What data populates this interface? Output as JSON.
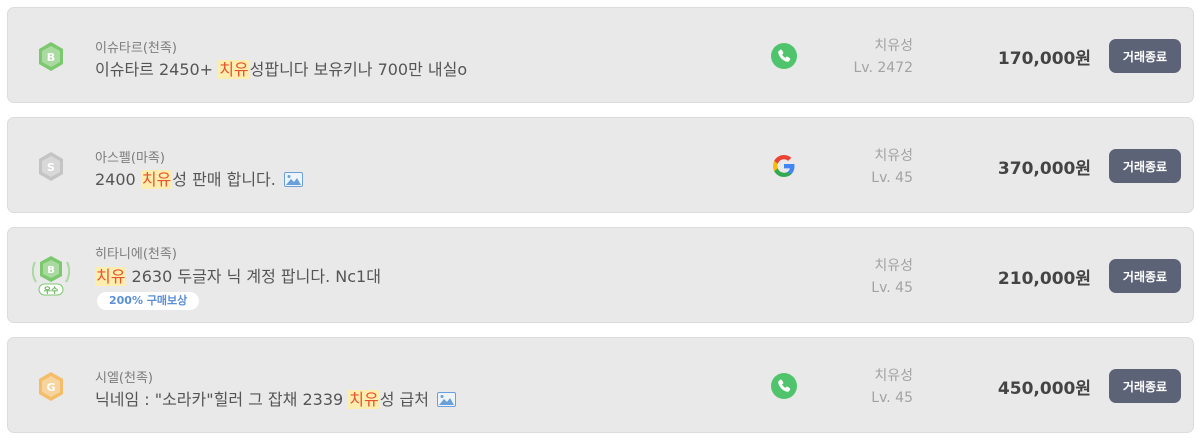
{
  "listings": [
    {
      "seller": "이슈타르(천족)",
      "title_pre": "이슈타르 2450+ ",
      "title_hl": "치유",
      "title_post": "성팝니다 보유키나 700만 내실o",
      "badge_letter": "B",
      "badge_color": "#7cc86f",
      "badge_label": "",
      "contact_icon": "phone-icon",
      "job": "치유성",
      "level": "Lv. 2472",
      "price": "170,000원",
      "action": "거래종료"
    },
    {
      "seller": "아스펠(마족)",
      "title_pre": "2400 ",
      "title_hl": "치유",
      "title_post": "성 판매 합니다.",
      "badge_letter": "S",
      "badge_color": "#c4c4c4",
      "badge_label": "",
      "contact_icon": "google-icon",
      "job": "치유성",
      "level": "Lv. 45",
      "price": "370,000원",
      "action": "거래종료"
    },
    {
      "seller": "히타니에(천족)",
      "title_pre": "",
      "title_hl": "치유",
      "title_post": " 2630 두글자 닉 계정 팝니다. Nc1대",
      "badge_letter": "B",
      "badge_color": "#7cc86f",
      "badge_label": "우수",
      "promo_tag": "200% 구매보상",
      "job": "치유성",
      "level": "Lv. 45",
      "price": "210,000원",
      "action": "거래종료"
    },
    {
      "seller": "시엘(천족)",
      "title_pre": "닉네임 : \"소라카\"힐러 그 잡채 2339 ",
      "title_hl": "치유",
      "title_post": "성 급처",
      "badge_letter": "G",
      "badge_color": "#f3bd6a",
      "badge_label": "",
      "contact_icon": "phone-icon",
      "job": "치유성",
      "level": "Lv. 45",
      "price": "450,000원",
      "action": "거래종료"
    }
  ]
}
